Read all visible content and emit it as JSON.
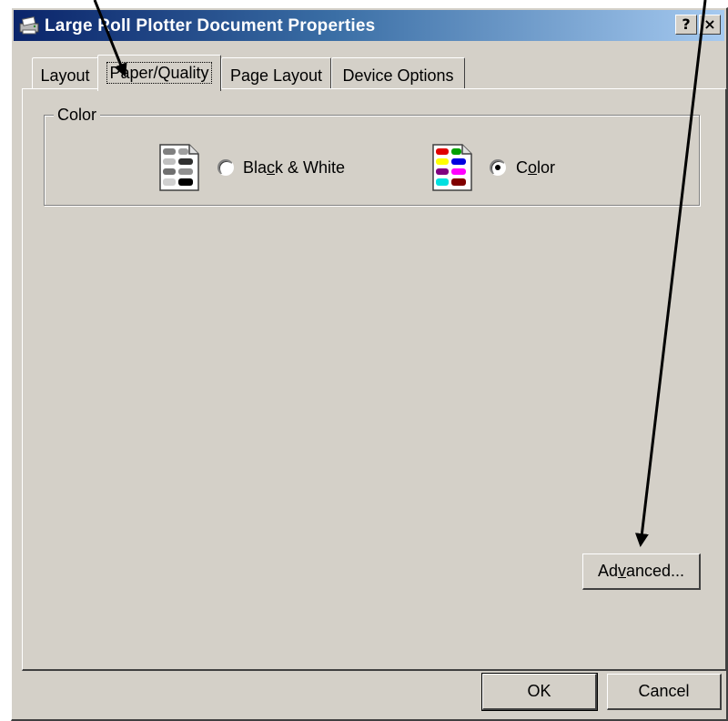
{
  "window": {
    "title": "Large Roll Plotter Document Properties",
    "help_glyph": "?",
    "close_glyph": "×"
  },
  "tabs": [
    {
      "label": "Layout",
      "active": false
    },
    {
      "label": "Paper/Quality",
      "active": true
    },
    {
      "label": "Page Layout",
      "active": false
    },
    {
      "label": "Device Options",
      "active": false
    }
  ],
  "color_group": {
    "legend": "Color",
    "options": [
      {
        "pre": "Bla",
        "key": "c",
        "post": "k & White",
        "selected": false,
        "icon": "grayscale-swatch-icon"
      },
      {
        "pre": "C",
        "key": "o",
        "post": "lor",
        "selected": true,
        "icon": "color-swatch-icon"
      }
    ]
  },
  "buttons": {
    "advanced": {
      "pre": "Ad",
      "key": "v",
      "post": "anced..."
    },
    "ok": "OK",
    "cancel": "Cancel"
  },
  "annotation_arrows": [
    "arrow-to-paper-quality-tab",
    "arrow-to-advanced-button"
  ]
}
